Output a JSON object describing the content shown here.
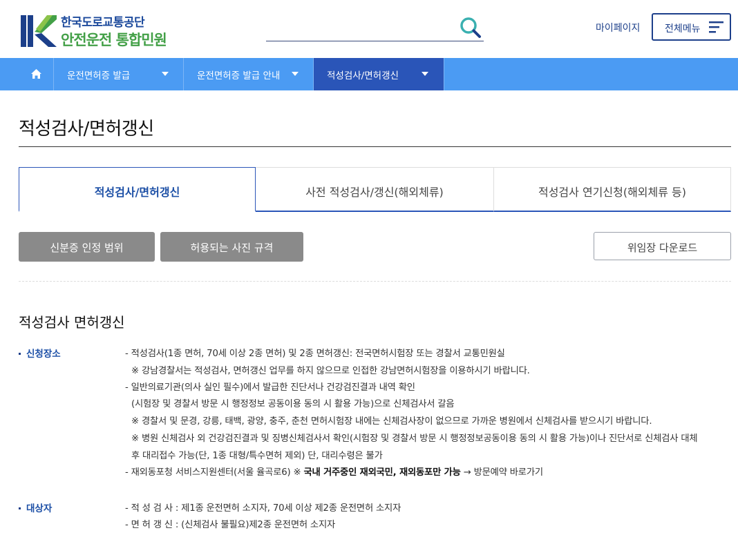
{
  "header": {
    "logo_line1": "한국도로교통공단",
    "logo_line2": "안전운전 통합민원",
    "search_placeholder": "",
    "mypage": "마이페이지",
    "allmenu": "전체메뉴"
  },
  "nav": {
    "items": [
      {
        "label": "운전면허증 발급"
      },
      {
        "label": "운전면허증 발급 안내"
      },
      {
        "label": "적성검사/면허갱신"
      }
    ]
  },
  "page": {
    "title": "적성검사/면허갱신"
  },
  "tabs": [
    {
      "label": "적성검사/면허갱신"
    },
    {
      "label": "사전 적성검사/갱신(해외체류)"
    },
    {
      "label": "적성검사 연기신청(해외체류 등)"
    }
  ],
  "buttons": {
    "id_scope": "신분증 인정 범위",
    "photo_spec": "허용되는 사진 규격",
    "proxy_download": "위임장 다운로드"
  },
  "section": {
    "title": "적성검사 면허갱신",
    "place_label": "신청장소",
    "place_lines": [
      "- 적성검사(1종 면허, 70세 이상 2종 면허) 및 2종 면허갱신: 전국면허시험장 또는 경찰서 교통민원실",
      "  ※ 강남경찰서는 적성검사, 면허갱신 업무를 하지 않으므로 인접한 강남면허시험장을 이용하시기 바랍니다.",
      "- 일반의료기관(의사 실인 필수)에서 발급한 진단서나 건강검진결과 내역 확인",
      "  (시험장 및 경찰서 방문 시 행정정보 공동이용 동의 시 활용 가능)으로 신체검사서 갈음",
      "  ※ 경찰서 및 문경, 강릉, 태백, 광양, 충주, 춘천 면허시험장 내에는 신체검사장이 없으므로 가까운 병원에서 신체검사를 받으시기 바랍니다.",
      "  ※ 병원 신체검사 외 건강검진결과 및 징병신체검사서 확인(시험장 및 경찰서 방문 시 행정정보공동이용 동의 시 활용 가능)이나 진단서로 신체검사 대체",
      "  후 대리접수 가능(단, 1종 대형/특수면허 제외) 단, 대리수령은 불가"
    ],
    "overseas_prefix": "- 재외동포청 서비스지원센터(서울 율곡로6) ※ ",
    "overseas_bold": "국내 거주중인 재외국민, 재외동포만 가능",
    "overseas_suffix": " → 방문예약 바로가기",
    "target_label": "대상자",
    "target_lines": [
      "- 적 성 검 사 : 제1종 운전면허 소지자, 70세 이상 제2종 운전면허 소지자",
      "- 면 허 갱 신 : (신체검사 불필요)제2종 운전면허 소지자"
    ]
  }
}
